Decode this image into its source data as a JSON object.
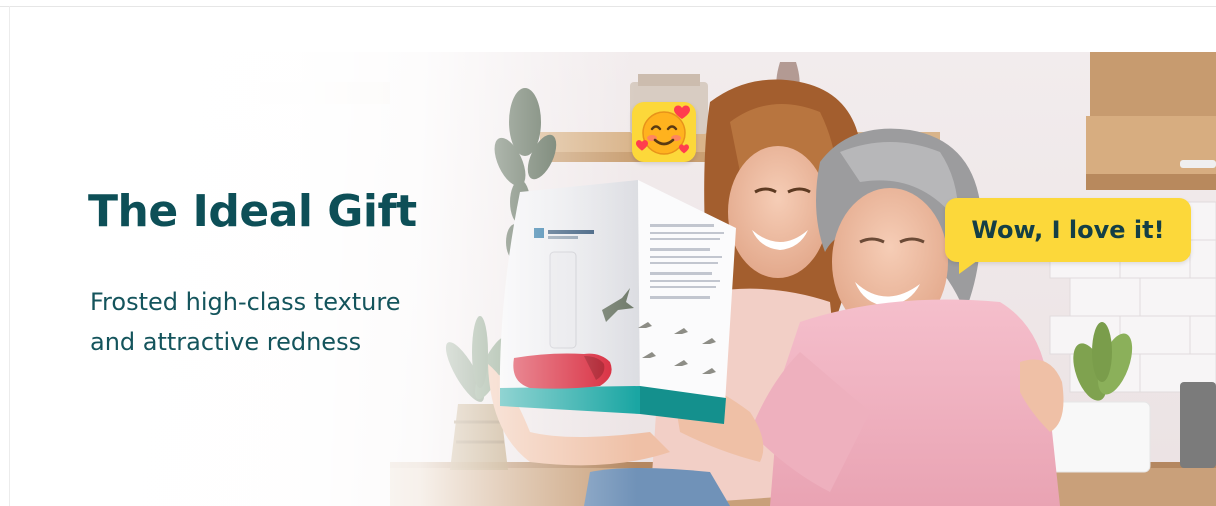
{
  "banner": {
    "headline": "The Ideal Gift",
    "subhead_lines": [
      "Frosted high-class texture",
      "and attractive redness"
    ],
    "speech_bubble": "Wow, I love it!",
    "emoji_icon": "smiling-face-with-hearts-icon",
    "colors": {
      "headline": "#0d4f57",
      "badge": "#fcd83a",
      "bubble_text": "#143f46",
      "box_teal": "#1aa6a3",
      "feeder_red": "#d61f33",
      "sweater_pink": "#f2b6c4"
    }
  }
}
